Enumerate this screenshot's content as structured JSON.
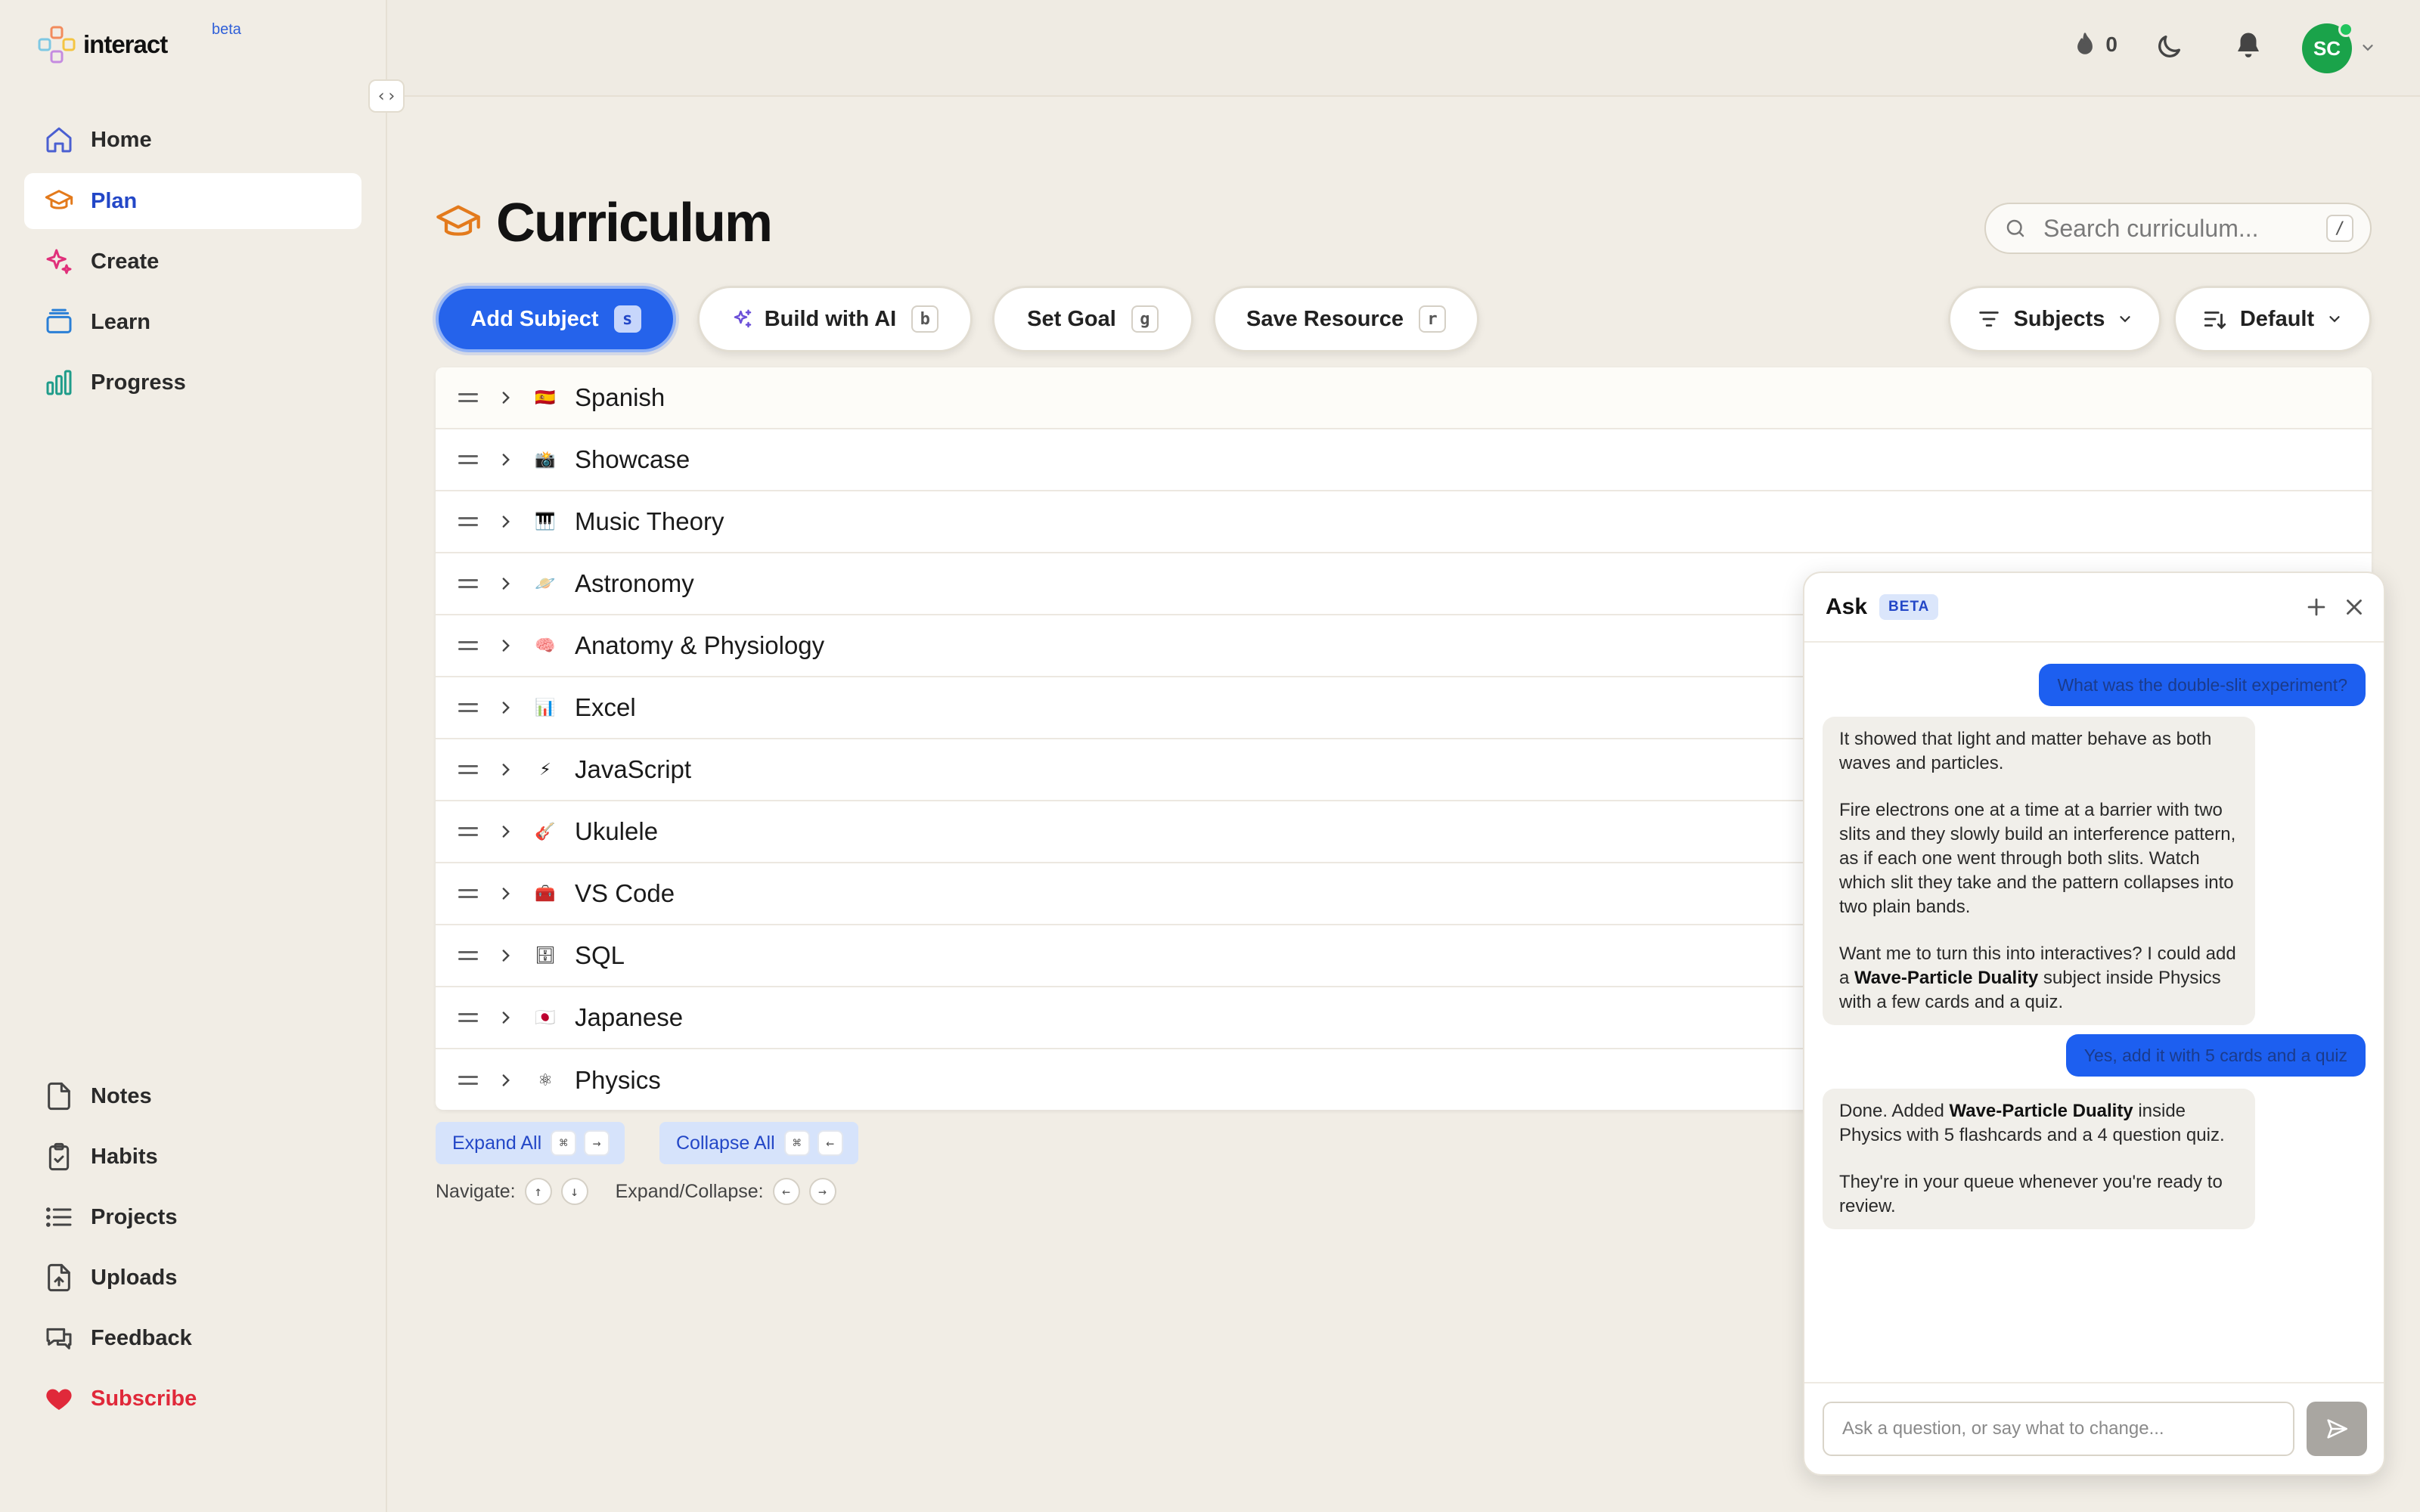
{
  "app": {
    "name": "interact",
    "badge": "beta"
  },
  "sidebar": {
    "primary": [
      {
        "label": "Home",
        "icon": "home-icon",
        "active": false
      },
      {
        "label": "Plan",
        "icon": "graduation-cap-icon",
        "active": true
      },
      {
        "label": "Create",
        "icon": "sparkle-icon",
        "active": false
      },
      {
        "label": "Learn",
        "icon": "layers-icon",
        "active": false
      },
      {
        "label": "Progress",
        "icon": "bar-chart-icon",
        "active": false
      }
    ],
    "secondary": [
      {
        "label": "Notes",
        "icon": "file-icon"
      },
      {
        "label": "Habits",
        "icon": "clipboard-check-icon"
      },
      {
        "label": "Projects",
        "icon": "list-icon"
      },
      {
        "label": "Uploads",
        "icon": "upload-file-icon"
      },
      {
        "label": "Feedback",
        "icon": "chat-bubbles-icon"
      },
      {
        "label": "Subscribe",
        "icon": "heart-icon"
      }
    ]
  },
  "topbar": {
    "streak_count": "0",
    "avatar_initials": "SC"
  },
  "main": {
    "title": "Curriculum",
    "search": {
      "placeholder": "Search curriculum...",
      "shortcut": "/"
    },
    "actions": [
      {
        "label": "Add Subject",
        "shortcut": "s"
      },
      {
        "label": "Build with AI",
        "shortcut": "b"
      },
      {
        "label": "Set Goal",
        "shortcut": "g"
      },
      {
        "label": "Save Resource",
        "shortcut": "r"
      }
    ],
    "filters": {
      "subjects_label": "Subjects",
      "sort_label": "Default"
    },
    "subjects": [
      {
        "name": "Spanish",
        "emoji": "🇪🇸"
      },
      {
        "name": "Showcase",
        "emoji": "📸"
      },
      {
        "name": "Music Theory",
        "emoji": "🎹"
      },
      {
        "name": "Astronomy",
        "emoji": "🪐"
      },
      {
        "name": "Anatomy & Physiology",
        "emoji": "🧠"
      },
      {
        "name": "Excel",
        "emoji": "📊"
      },
      {
        "name": "JavaScript",
        "emoji": "⚡"
      },
      {
        "name": "Ukulele",
        "emoji": "🎸"
      },
      {
        "name": "VS Code",
        "emoji": "🧰"
      },
      {
        "name": "SQL",
        "emoji": "🗄"
      },
      {
        "name": "Japanese",
        "emoji": "🇯🇵"
      },
      {
        "name": "Physics",
        "emoji": "⚛"
      }
    ],
    "footer": {
      "expand_label": "Expand All",
      "collapse_label": "Collapse All",
      "cmd_key": "⌘",
      "right_key": "→",
      "left_key": "←",
      "up_key": "↑",
      "down_key": "↓",
      "navigate_label": "Navigate:",
      "expand_collapse_label": "Expand/Collapse:"
    }
  },
  "ask": {
    "title": "Ask",
    "badge": "BETA",
    "messages": {
      "user_1": "What was the double-slit experiment?",
      "ai_1_p1": "It showed that light and matter behave as both waves and particles.",
      "ai_1_p2": "Fire electrons one at a time at a barrier with two slits and they slowly build an interference pattern, as if each one went through both slits. Watch which slit they take and the pattern collapses into two plain bands.",
      "ai_1_p3_pre": "Want me to turn this into interactives? I could add a ",
      "ai_1_p3_bold": "Wave-Particle Duality",
      "ai_1_p3_post": " subject inside Physics with a few cards and a quiz.",
      "user_2": "Yes, add it with 5 cards and a quiz",
      "ai_2_p1_pre": "Done. Added ",
      "ai_2_p1_bold": "Wave-Particle Duality",
      "ai_2_p1_post": " inside Physics with 5 flashcards and a 4 question quiz.",
      "ai_2_p2": "They're in your queue whenever you're ready to review."
    },
    "input_placeholder": "Ask a question, or say what to change..."
  },
  "colors": {
    "accent": "#2563eb",
    "active_nav_text": "#2347c7",
    "subscribe": "#e0293a",
    "avatar": "#1aa34a",
    "background": "#f1ede5"
  }
}
